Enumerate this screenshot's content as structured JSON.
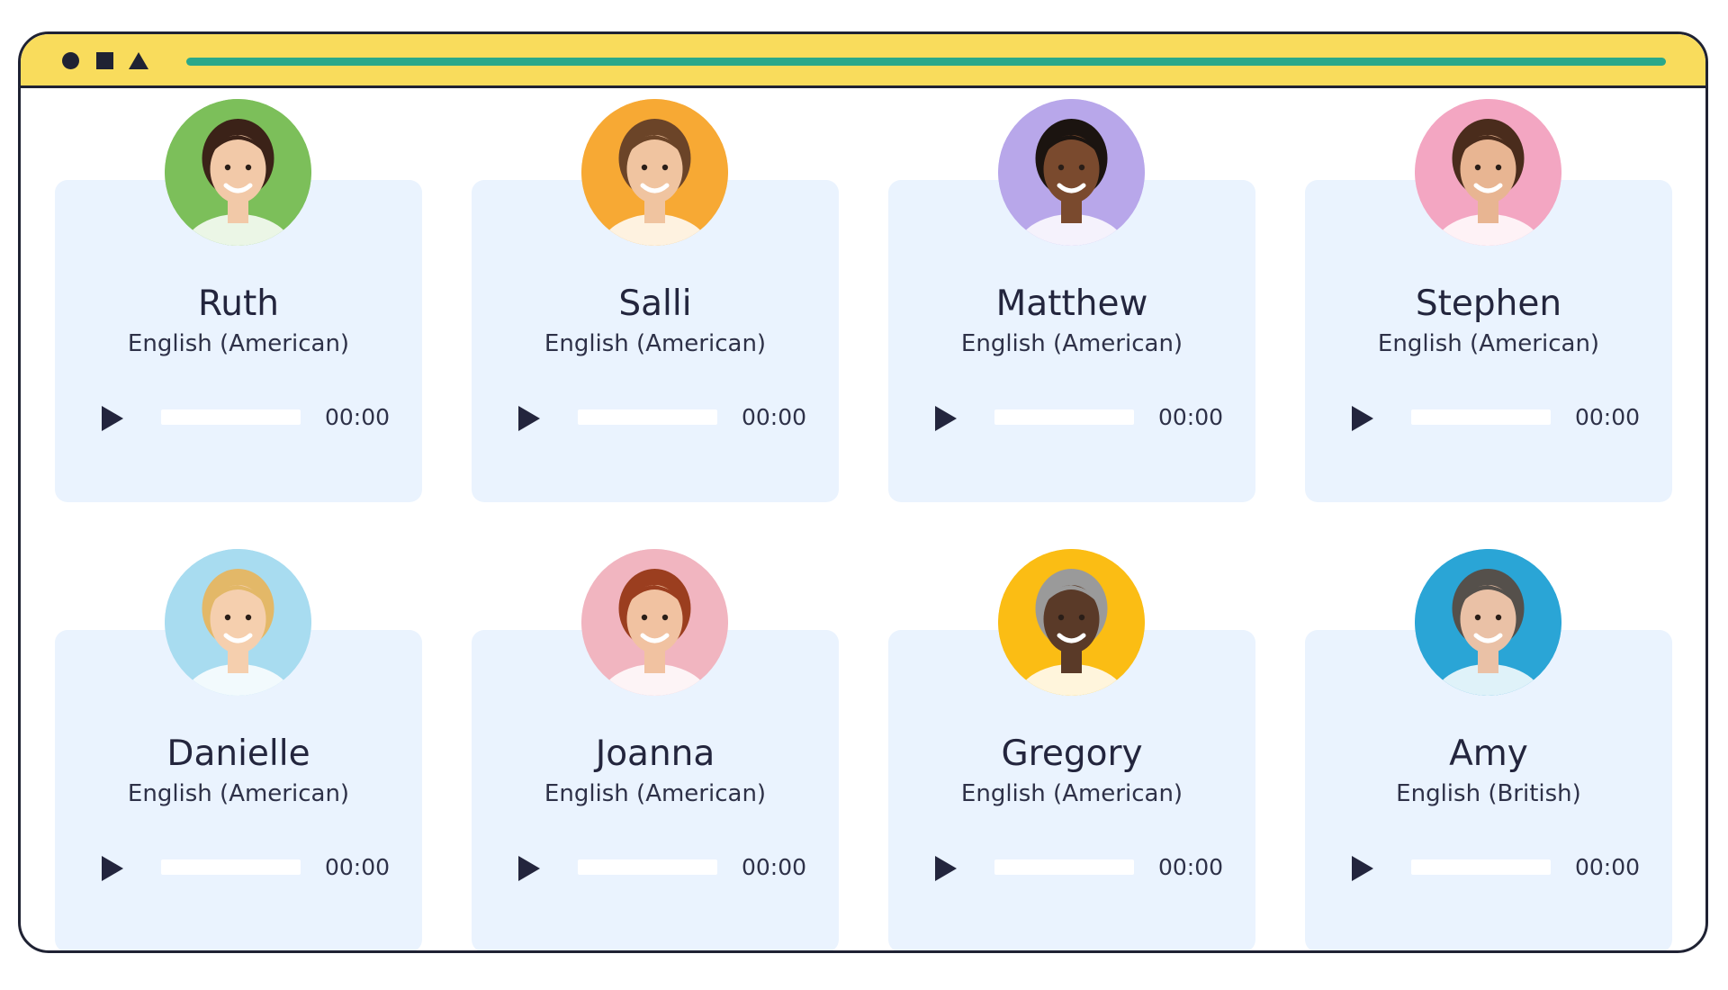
{
  "window": {
    "accent_color": "#f9dc5c",
    "url_bar_color": "#2aa88a",
    "controls": [
      "circle-icon",
      "square-icon",
      "triangle-icon"
    ]
  },
  "voices": [
    {
      "name": "Ruth",
      "language": "English (American)",
      "time": "00:00",
      "avatar_bg": "#7cbf5a"
    },
    {
      "name": "Salli",
      "language": "English (American)",
      "time": "00:00",
      "avatar_bg": "#f7a934"
    },
    {
      "name": "Matthew",
      "language": "English (American)",
      "time": "00:00",
      "avatar_bg": "#b8a7ea"
    },
    {
      "name": "Stephen",
      "language": "English (American)",
      "time": "00:00",
      "avatar_bg": "#f3a6c2"
    },
    {
      "name": "Danielle",
      "language": "English (American)",
      "time": "00:00",
      "avatar_bg": "#a8dcf0"
    },
    {
      "name": "Joanna",
      "language": "English (American)",
      "time": "00:00",
      "avatar_bg": "#f1b5c0"
    },
    {
      "name": "Gregory",
      "language": "English (American)",
      "time": "00:00",
      "avatar_bg": "#fbbd14"
    },
    {
      "name": "Amy",
      "language": "English (British)",
      "time": "00:00",
      "avatar_bg": "#2aa5d6"
    }
  ]
}
